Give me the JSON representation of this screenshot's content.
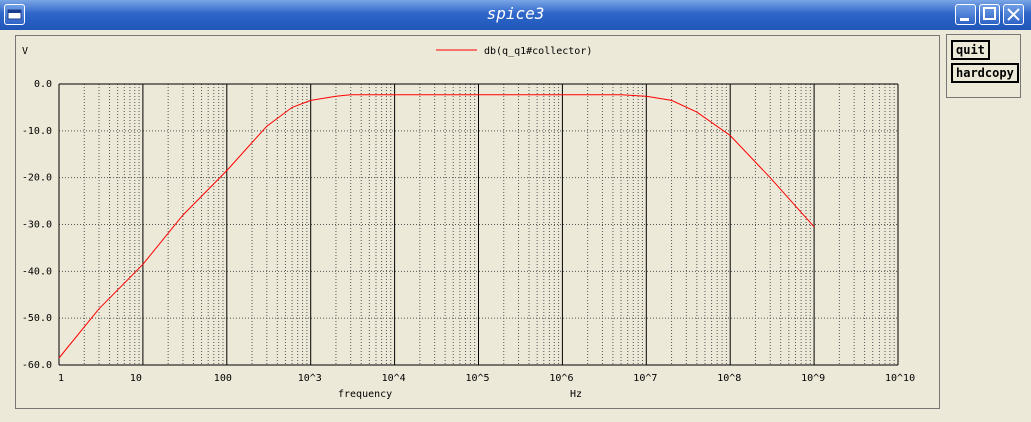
{
  "window": {
    "title": "spice3"
  },
  "buttons": {
    "quit": "quit",
    "hardcopy": "hardcopy"
  },
  "plot": {
    "y_unit_label": "V",
    "legend_label": "db(q_q1#collector)",
    "x_label": "frequency",
    "x_unit": "Hz",
    "y_ticks": [
      "0.0",
      "-10.0",
      "-20.0",
      "-30.0",
      "-40.0",
      "-50.0",
      "-60.0"
    ],
    "x_ticks": [
      "1",
      "10",
      "100",
      "10^3",
      "10^4",
      "10^5",
      "10^6",
      "10^7",
      "10^8",
      "10^9",
      "10^10"
    ]
  },
  "chart_data": {
    "type": "line",
    "x_scale": "log",
    "xlabel": "frequency",
    "ylabel": "V",
    "xlim": [
      1,
      10000000000
    ],
    "ylim": [
      -60,
      0
    ],
    "grid": true,
    "legend": "top-center",
    "series": [
      {
        "name": "db(q_q1#collector)",
        "color": "#ff0000",
        "x": [
          1,
          3,
          10,
          30,
          100,
          300,
          600,
          1000,
          2000,
          3000,
          10000,
          100000,
          1000000,
          5000000,
          10000000,
          20000000,
          40000000,
          100000000,
          300000000,
          1000000000
        ],
        "y": [
          -58.5,
          -48,
          -38.5,
          -28,
          -18.5,
          -9,
          -5,
          -3.5,
          -2.6,
          -2.3,
          -2.3,
          -2.3,
          -2.3,
          -2.3,
          -2.6,
          -3.5,
          -6,
          -11,
          -20,
          -30.5
        ]
      }
    ]
  }
}
